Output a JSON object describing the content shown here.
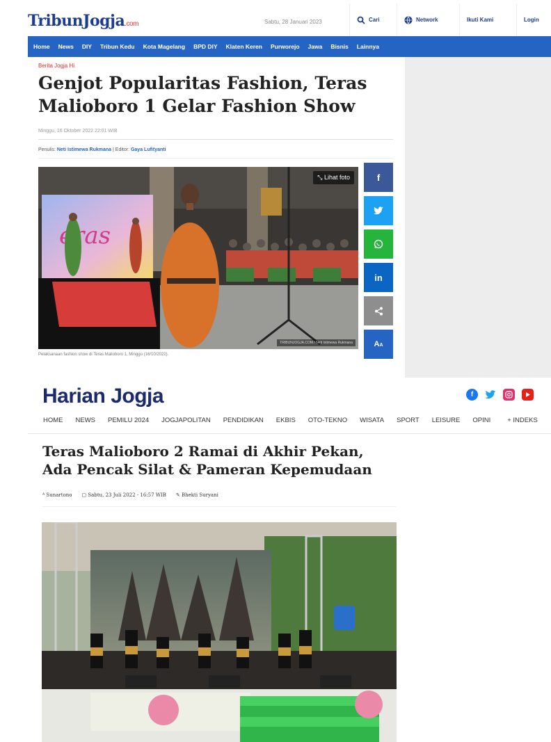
{
  "tribun": {
    "logo": "TribunJogja",
    "logo_suffix": ".com",
    "date": "Sabtu, 28 Januari 2023",
    "search_label": "Cari",
    "network_label": "Network",
    "follow_label": "Ikuti Kami",
    "login_label": "Login",
    "nav": [
      "Home",
      "News",
      "DIY",
      "Tribun Kedu",
      "Kota Magelang",
      "BPD DIY",
      "Klaten Keren",
      "Purworejo",
      "Jawa",
      "Bisnis",
      "Lainnya"
    ],
    "kicker": "Berita Jogja Hi",
    "title": "Genjot Popularitas Fashion, Teras Malioboro 1 Gelar Fashion Show",
    "published": "Minggu, 16 Oktober 2022 22:01 WIB",
    "author_prefix": "Penulis:",
    "author": "Neti Istimewa Rukmana",
    "editor_prefix": "| Editor:",
    "editor": "Gaya Lufityanti",
    "photo_button": "Lihat foto",
    "photo_credit": "TRIBUNJOGJA.COM / Neti Istimewa Rukmana",
    "caption": "Pelaksanaan fashion show di Teras Malioboro 1, Minggu (16/10/2022).",
    "share_font_label": "A",
    "colors": {
      "nav": "#2664c4",
      "kicker": "#d8302a",
      "facebook": "#3b5998",
      "twitter": "#1da1f2",
      "whatsapp": "#25b43c",
      "linkedin": "#0a66c2",
      "share": "#8e8e8e",
      "font": "#2664c4"
    }
  },
  "harian": {
    "logo_a": "Harian ",
    "logo_b": "Jogja",
    "nav": [
      "HOME",
      "NEWS",
      "PEMILU 2024",
      "JOGJAPOLITAN",
      "PENDIDIKAN",
      "EKBIS",
      "OTO-TEKNO",
      "WISATA",
      "SPORT",
      "LEISURE",
      "OPINI",
      "+ INDEKS"
    ],
    "title": "Teras Malioboro 2 Ramai di Akhir Pekan, Ada Pencak Silat & Pameran Kepemudaan",
    "reporter": "Sunartono",
    "date": "Sabtu, 23 Juli 2022 - 16:57 WIB",
    "editor": "Bhekti Suryani",
    "colors": {
      "logo": "#1b2a6b",
      "facebook": "#1877f2",
      "twitter": "#1da1f2",
      "instagram": "#e1306c",
      "youtube": "#e62117"
    }
  }
}
